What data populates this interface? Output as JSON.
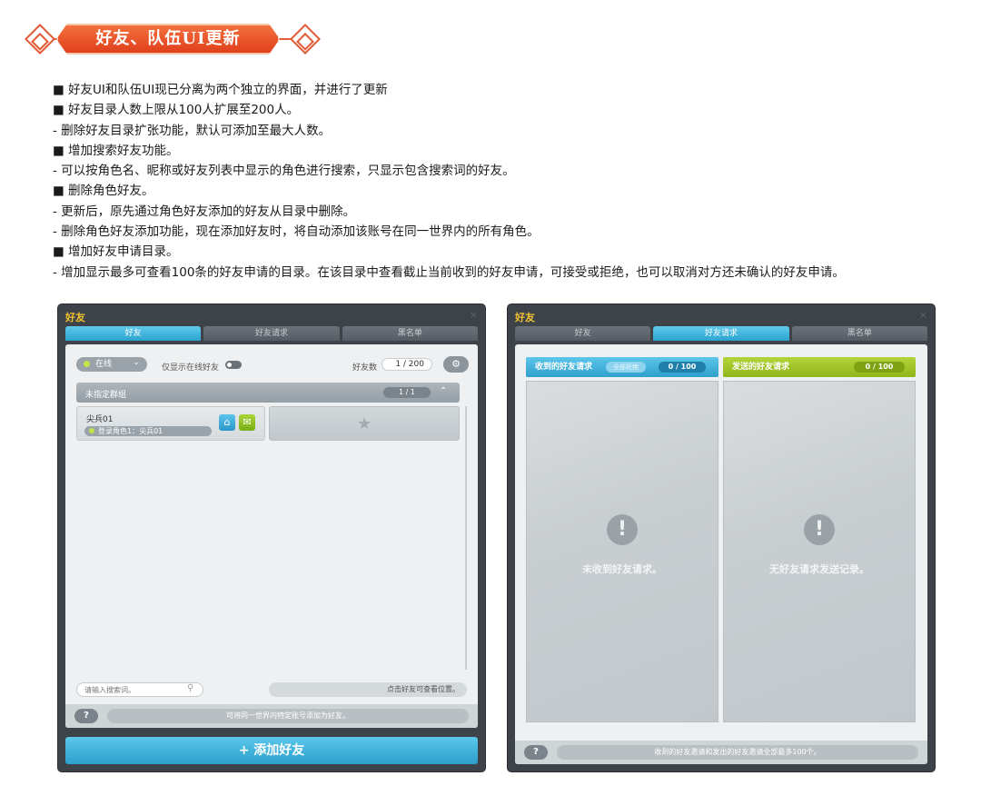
{
  "banner": {
    "title": "好友、队伍UI更新"
  },
  "notes": [
    "■ 好友UI和队伍UI现已分离为两个独立的界面，并进行了更新",
    "■ 好友目录人数上限从100人扩展至200人。",
    "- 删除好友目录扩张功能，默认可添加至最大人数。",
    "■ 增加搜索好友功能。",
    "- 可以按角色名、昵称或好友列表中显示的角色进行搜索，只显示包含搜索词的好友。",
    "■ 删除角色好友。",
    "- 更新后，原先通过角色好友添加的好友从目录中删除。",
    "- 删除角色好友添加功能，现在添加好友时，将自动添加该账号在同一世界内的所有角色。",
    "■ 增加好友申请目录。",
    "- 增加显示最多可查看100条的好友申请的目录。在该目录中查看截止当前收到的好友申请，可接受或拒绝，也可以取消对方还未确认的好友申请。"
  ],
  "left_window": {
    "title": "好友",
    "close": "×",
    "tabs": [
      "好友",
      "好友请求",
      "黑名单"
    ],
    "status_label": "在线",
    "status_chevron": "⌄",
    "online_only_label": "仅显示在线好友",
    "count_label": "好友数",
    "count_value": "1 / 200",
    "settings_icon": "⚙",
    "group": {
      "name": "未指定群组",
      "count": "1 / 1",
      "collapse": "⌃"
    },
    "friend": {
      "name": "尖兵01",
      "character": "登录角色1：尖兵01",
      "home_icon": "⌂",
      "message_icon": "✉"
    },
    "empty_slot_icon": "★",
    "search_placeholder": "请输入搜索词。",
    "search_icon": "⚲",
    "location_hint": "点击好友可查看位置。",
    "help": "?",
    "bottom_hint": "可将同一世界内特定账号添加为好友。",
    "add_button": "+ 添加好友"
  },
  "right_window": {
    "title": "好友",
    "close": "×",
    "tabs": [
      "好友",
      "好友请求",
      "黑名单"
    ],
    "received": {
      "label": "收到的好友请求",
      "reject_all": "全部拒绝",
      "count": "0 / 100",
      "empty": "未收到好友请求。"
    },
    "sent": {
      "label": "发送的好友请求",
      "count": "0 / 100",
      "empty": "无好友请求发送记录。"
    },
    "warn_icon": "!",
    "help": "?",
    "bottom_hint": "收到的好友邀请和发出的好友邀请全部最多100个。"
  },
  "colors": {
    "accent_blue": "#2ba3cf",
    "accent_green": "#8fb519",
    "banner_red": "#e0401c",
    "title_gold": "#f2c12e"
  }
}
